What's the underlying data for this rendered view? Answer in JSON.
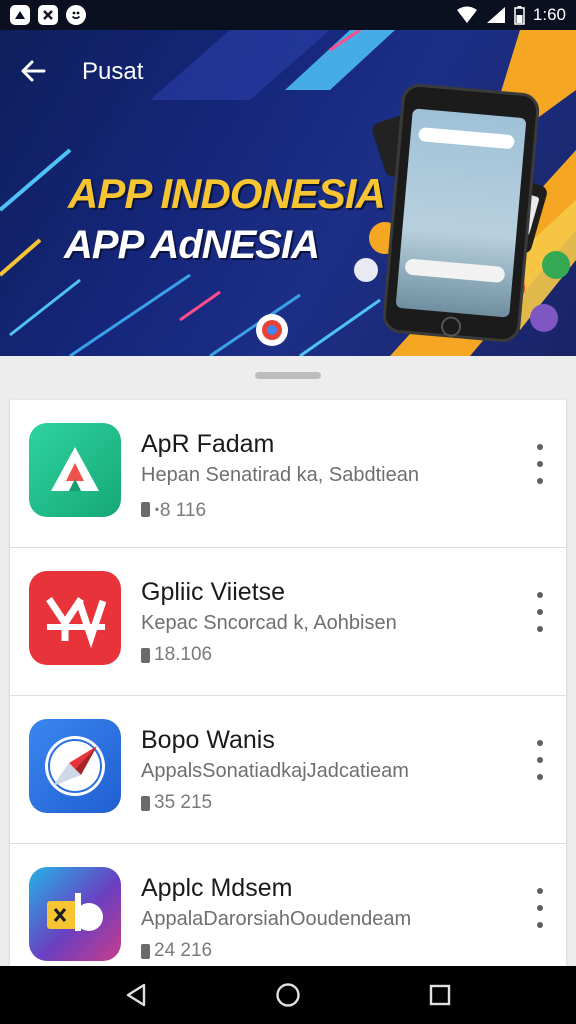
{
  "status_bar": {
    "time": "1:60",
    "left_icons": [
      "notification-icon",
      "close-box-icon",
      "smile-icon"
    ],
    "right_icons": [
      "wifi-icon",
      "signal-icon",
      "battery-icon"
    ]
  },
  "header": {
    "title": "Pusat",
    "back_icon": "arrow-left-icon"
  },
  "banner": {
    "headline": "APP INDONESIA",
    "subheadline": "APP AdNESIA",
    "colors": {
      "background": "#15267a",
      "headline": "#f6c531",
      "subheadline": "#ffffff",
      "accent": "#f5a623"
    }
  },
  "apps": [
    {
      "name": "ApR Fadam",
      "description": "Hepan Senatirad ka, Sabdtiean",
      "meta": "ꞏ8 116",
      "icon": "triangle-logo-icon",
      "icon_color": "#21c08b"
    },
    {
      "name": "Gpliic Viietse",
      "description": "Kepac Sncorcad k, Aohbisen",
      "meta": "18.106",
      "icon": "yv-logo-icon",
      "icon_color": "#e8333a"
    },
    {
      "name": "Bopo Wanis",
      "description": "AppalsSonatiadkajJadcatieam",
      "meta": "35 215",
      "icon": "compass-icon",
      "icon_color": "#2a6fe0"
    },
    {
      "name": "Applc Mdsem",
      "description": "AppalaDarorsiahOoudendeam",
      "meta": "24 216",
      "icon": "puzzle-logo-icon",
      "icon_color": "#6a3fc1"
    }
  ],
  "nav_bar": {
    "back": "nav-back-icon",
    "home": "nav-home-icon",
    "recents": "nav-recents-icon"
  }
}
